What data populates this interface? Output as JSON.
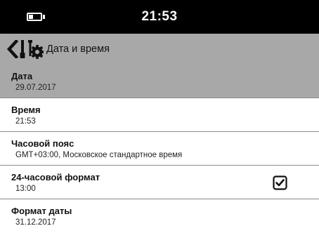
{
  "status_bar": {
    "time": "21:53",
    "battery_level": 0.35
  },
  "action_bar": {
    "title": "Дата и время",
    "back_icon": "chevron-left-icon",
    "app_icon": "tools-gear-icon"
  },
  "settings": [
    {
      "title": "Дата",
      "summary": "29.07.2017",
      "selected": true
    },
    {
      "title": "Время",
      "summary": "21:53"
    },
    {
      "title": "Часовой пояс",
      "summary": "GMT+03:00, Московское стандартное время"
    },
    {
      "title": "24-часовой формат",
      "summary": "13:00",
      "checked": true
    },
    {
      "title": "Формат даты",
      "summary": "31.12.2017"
    }
  ],
  "colors": {
    "status_bar": "#000000",
    "action_bar": "#a8a8a8",
    "selected_row": "#a8a8a8",
    "divider": "#8a8a8a"
  }
}
